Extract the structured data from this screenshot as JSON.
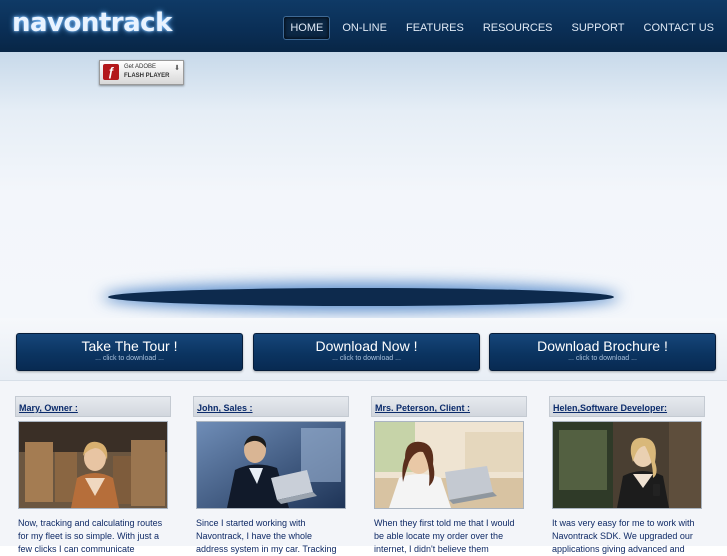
{
  "header": {
    "logo_text": "navontrack",
    "nav": [
      {
        "label": "HOME",
        "active": true
      },
      {
        "label": "ON-LINE",
        "active": false
      },
      {
        "label": "FEATURES",
        "active": false
      },
      {
        "label": "RESOURCES",
        "active": false
      },
      {
        "label": "SUPPORT",
        "active": false
      },
      {
        "label": "CONTACT US",
        "active": false
      }
    ]
  },
  "hero": {
    "flash_badge": {
      "get_text": "Get ADOBE",
      "player_text": "FLASH PLAYER",
      "icon": "flash-player-icon"
    }
  },
  "cta": [
    {
      "title": "Take The Tour !",
      "subtitle": "... click to download ..."
    },
    {
      "title": "Download Now !",
      "subtitle": "... click to download ..."
    },
    {
      "title": "Download Brochure !",
      "subtitle": "... click to download ..."
    }
  ],
  "testimonials": [
    {
      "name": "Mary, Owner :",
      "text": "Now, tracking and calculating routes for my fleet is so simple. With just a few clicks I can communicate"
    },
    {
      "name": "John, Sales :",
      "text": "Since I started working with Navontrack, I have the whole address system in my car. Tracking"
    },
    {
      "name": "Mrs. Peterson, Client :",
      "text": "When they first told me that I would be able locate my order over the internet, I didn't believe them"
    },
    {
      "name": "Helen,Software Developer:",
      "text": "It was very easy for me to work with Navontrack SDK. We upgraded our applications giving advanced and"
    }
  ],
  "colors": {
    "brand_dark": "#0a2e55",
    "link": "#0b2b6b",
    "body_text": "#0f2a66"
  }
}
